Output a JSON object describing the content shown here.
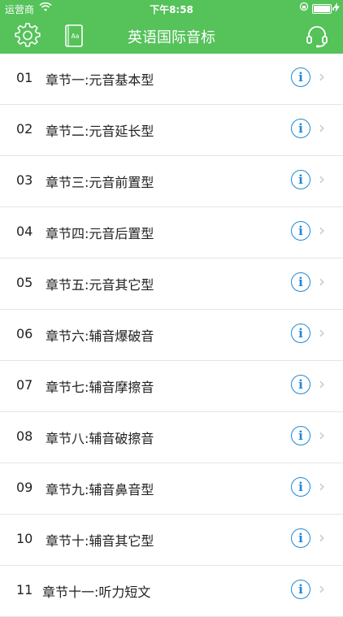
{
  "status_bar": {
    "carrier": "运营商",
    "time": "下午8:58"
  },
  "header": {
    "title": "英语国际音标",
    "settings_icon": "gear-icon",
    "book_icon": "dictionary-book-icon",
    "audio_icon": "headset-icon",
    "color": "#55c25a"
  },
  "chapters": [
    {
      "num": "01",
      "label": "章节一:元音基本型"
    },
    {
      "num": "02",
      "label": "章节二:元音延长型"
    },
    {
      "num": "03",
      "label": "章节三:元音前置型"
    },
    {
      "num": "04",
      "label": "章节四:元音后置型"
    },
    {
      "num": "05",
      "label": "章节五:元音其它型"
    },
    {
      "num": "06",
      "label": "章节六:辅音爆破音"
    },
    {
      "num": "07",
      "label": "章节七:辅音摩擦音"
    },
    {
      "num": "08",
      "label": "章节八:辅音破擦音"
    },
    {
      "num": "09",
      "label": "章节九:辅音鼻音型"
    },
    {
      "num": "10",
      "label": "章节十:辅音其它型"
    },
    {
      "num": "11",
      "label": "章节十一:听力短文"
    }
  ],
  "info_glyph": "i",
  "chevron_glyph": "›",
  "accent_color": "#1e88d6"
}
